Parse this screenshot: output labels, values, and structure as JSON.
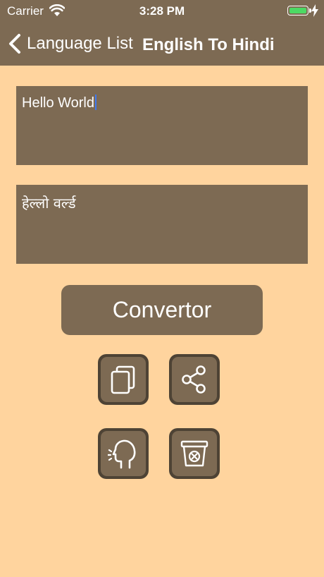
{
  "status_bar": {
    "carrier": "Carrier",
    "time": "3:28 PM",
    "battery_color": "#4CD964"
  },
  "nav": {
    "back_label": "Language List",
    "title": "English To Hindi"
  },
  "input": {
    "text": "Hello World"
  },
  "output": {
    "text": "हेल्लो वर्ल्ड"
  },
  "convert_button": {
    "label": "Convertor"
  },
  "actions": [
    {
      "icon": "copy-icon"
    },
    {
      "icon": "share-icon"
    },
    {
      "icon": "speak-icon"
    },
    {
      "icon": "clear-icon"
    }
  ],
  "colors": {
    "background": "#FFD49E",
    "bar": "#7D6A53",
    "button_border": "#4E4335"
  }
}
